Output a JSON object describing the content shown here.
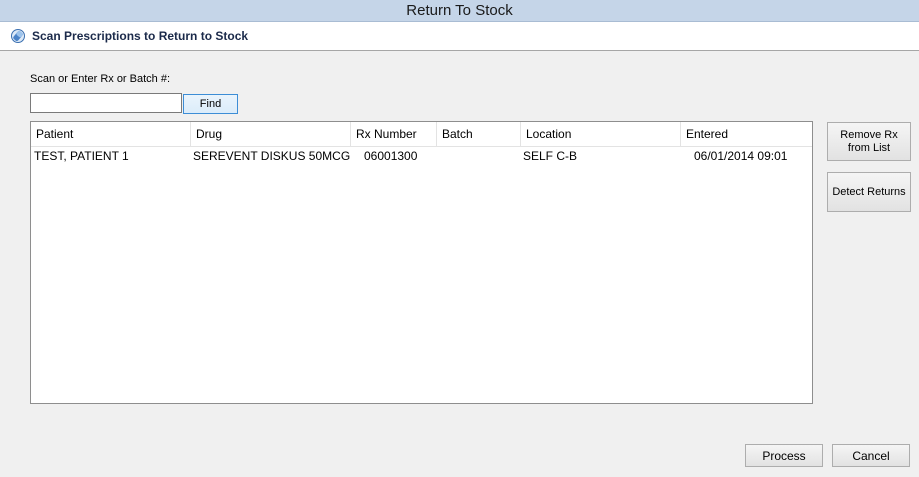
{
  "window": {
    "title": "Return To Stock"
  },
  "header": {
    "title": "Scan Prescriptions to Return to Stock",
    "icon": "pill-bottle-icon"
  },
  "scan": {
    "label": "Scan or Enter Rx or Batch #:",
    "value": "",
    "find_label": "Find"
  },
  "table": {
    "columns": [
      "Patient",
      "Drug",
      "Rx Number",
      "Batch",
      "Location",
      "Entered"
    ],
    "rows": [
      {
        "patient": "TEST, PATIENT 1",
        "drug": "SEREVENT DISKUS 50MCG",
        "rx_number": "06001300",
        "batch": "",
        "location": "SELF C-B",
        "entered": "06/01/2014 09:01"
      }
    ]
  },
  "actions": {
    "remove_line1": "Remove Rx",
    "remove_line2": "from List",
    "detect": "Detect Returns",
    "process": "Process",
    "cancel": "Cancel"
  },
  "colors": {
    "titlebar": "#c5d5e8",
    "background": "#f0f0f0",
    "find_border": "#3c8dd6"
  }
}
